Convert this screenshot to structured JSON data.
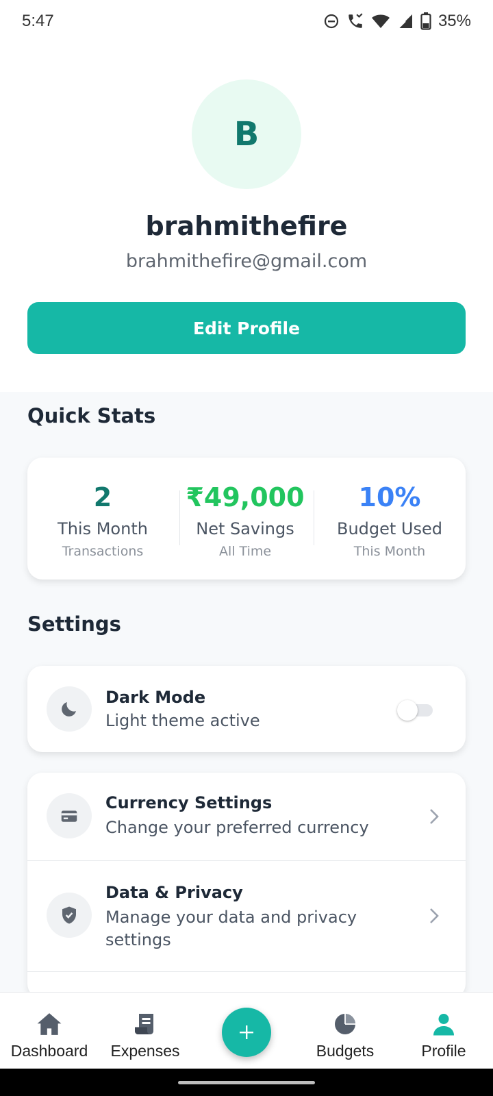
{
  "status_bar": {
    "time": "5:47",
    "battery": "35%"
  },
  "profile": {
    "avatar_initial": "B",
    "username": "brahmithefire",
    "email": "brahmithefire@gmail.com",
    "edit_button": "Edit Profile"
  },
  "quick_stats": {
    "title": "Quick Stats",
    "items": [
      {
        "value": "2",
        "label": "This Month",
        "sub": "Transactions",
        "color": "#11786d"
      },
      {
        "value": "₹49,000",
        "label": "Net Savings",
        "sub": "All Time",
        "color": "#22c55e"
      },
      {
        "value": "10%",
        "label": "Budget Used",
        "sub": "This Month",
        "color": "#3b82f6"
      }
    ]
  },
  "settings": {
    "title": "Settings",
    "dark_mode": {
      "title": "Dark Mode",
      "subtitle": "Light theme active",
      "enabled": false
    },
    "items": [
      {
        "title": "Currency Settings",
        "subtitle": "Change your preferred currency",
        "icon": "card-icon"
      },
      {
        "title": "Data & Privacy",
        "subtitle": "Manage your data and privacy settings",
        "icon": "shield-icon"
      }
    ]
  },
  "bottom_nav": {
    "items": [
      {
        "label": "Dashboard",
        "icon": "home-icon"
      },
      {
        "label": "Expenses",
        "icon": "receipt-icon"
      },
      {
        "label": "Budgets",
        "icon": "pie-icon"
      },
      {
        "label": "Profile",
        "icon": "person-icon",
        "active": true
      }
    ],
    "accent": "#16b8a6"
  }
}
